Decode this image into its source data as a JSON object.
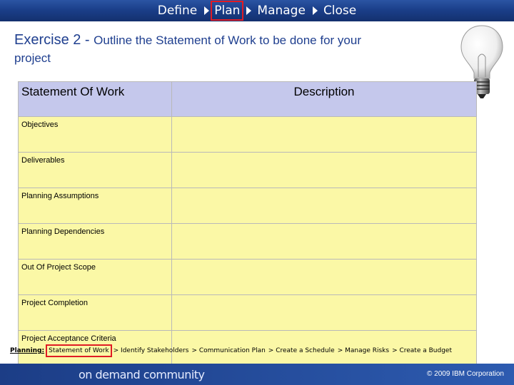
{
  "nav": {
    "items": [
      {
        "label": "Define"
      },
      {
        "label": "Plan"
      },
      {
        "label": "Manage"
      },
      {
        "label": "Close"
      }
    ]
  },
  "title": {
    "part1": "Exercise 2 - ",
    "part2": "Outline the Statement of Work  to be done for your",
    "part3": "project"
  },
  "table": {
    "headers": [
      "Statement Of Work",
      "Description"
    ],
    "rows": [
      {
        "label": "Objectives",
        "value": ""
      },
      {
        "label": "Deliverables",
        "value": ""
      },
      {
        "label": "Planning Assumptions",
        "value": ""
      },
      {
        "label": "Planning Dependencies",
        "value": ""
      },
      {
        "label": "Out Of Project Scope",
        "value": ""
      },
      {
        "label": "Project Completion",
        "value": ""
      },
      {
        "label": "Project Acceptance Criteria",
        "value": ""
      }
    ]
  },
  "footer_plan": {
    "lead": "Planning:",
    "current": "Statement of Work",
    "steps": [
      "> Identify Stakeholders",
      "> Communication Plan",
      "> Create a Schedule",
      "> Manage Risks",
      "> Create a Budget"
    ]
  },
  "bottom": {
    "logo_text": "on demand community",
    "copyright": "© 2009 IBM Corporation"
  },
  "colors": {
    "nav_bar": "#1b3f8a",
    "title_text": "#1f3f8f",
    "header_fill": "#c5c8ec",
    "cell_fill": "#fbf8a6",
    "highlight": "#e01b24"
  },
  "icons": [
    "light-bulb-icon",
    "triangle-right-icon"
  ]
}
